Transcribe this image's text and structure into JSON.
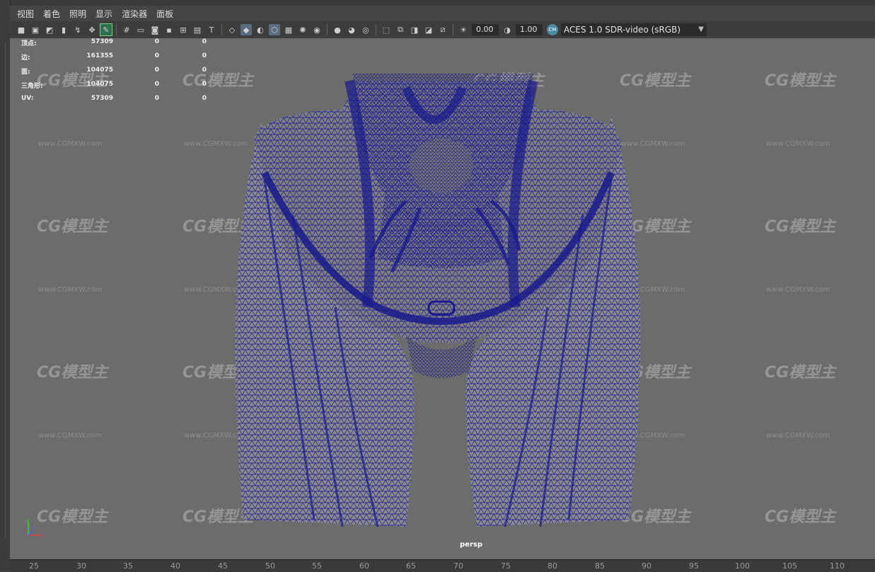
{
  "menu": {
    "items": [
      "视图",
      "着色",
      "照明",
      "显示",
      "渲染器",
      "面板"
    ]
  },
  "toolbar": {
    "icons": [
      "camera-icon",
      "camera-attr-icon",
      "bookmark-icon",
      "bookmark2-icon",
      "snap-icon",
      "2d-pan-icon",
      "grease-pencil-icon",
      "grid-icon",
      "film-gate-icon",
      "resolution-gate-icon",
      "gate-mask-icon",
      "field-chart-icon",
      "safe-action-icon",
      "safe-title-icon",
      "wireframe-icon",
      "smooth-shade-icon",
      "default-material-icon",
      "wireframe-on-shaded-icon",
      "textured-icon",
      "lights-icon",
      "shadows-icon",
      "ambient-occlusion-icon",
      "motion-blur-icon",
      "antialias-icon",
      "isolate-icon",
      "xray-icon",
      "xray-joints-icon",
      "xray-components-icon",
      "backface-icon",
      "exposure-icon",
      "gamma-icon"
    ],
    "exposure_value": "0.00",
    "gamma_value": "1.00",
    "color_space": "ACES 1.0 SDR-video (sRGB)"
  },
  "hud": {
    "rows": [
      {
        "label": "顶点:",
        "v1": "57309",
        "v2": "0",
        "v3": "0"
      },
      {
        "label": "边:",
        "v1": "161355",
        "v2": "0",
        "v3": "0"
      },
      {
        "label": "面:",
        "v1": "104075",
        "v2": "0",
        "v3": "0"
      },
      {
        "label": "三角形:",
        "v1": "104075",
        "v2": "0",
        "v3": "0"
      },
      {
        "label": "UV:",
        "v1": "57309",
        "v2": "0",
        "v3": "0"
      }
    ]
  },
  "viewport": {
    "camera_label": "persp",
    "watermark_logo": "CG模型主",
    "watermark_url": "www.CGMXW.com",
    "mesh_color": "#1a1a9a",
    "background_color": "#6c6c6c"
  },
  "ruler": {
    "ticks": [
      "25",
      "30",
      "35",
      "40",
      "45",
      "50",
      "55",
      "60",
      "65",
      "70",
      "75",
      "80",
      "85",
      "90",
      "95",
      "100",
      "105",
      "110"
    ]
  },
  "axis": {
    "x": "x",
    "y": "y",
    "z": "z"
  }
}
